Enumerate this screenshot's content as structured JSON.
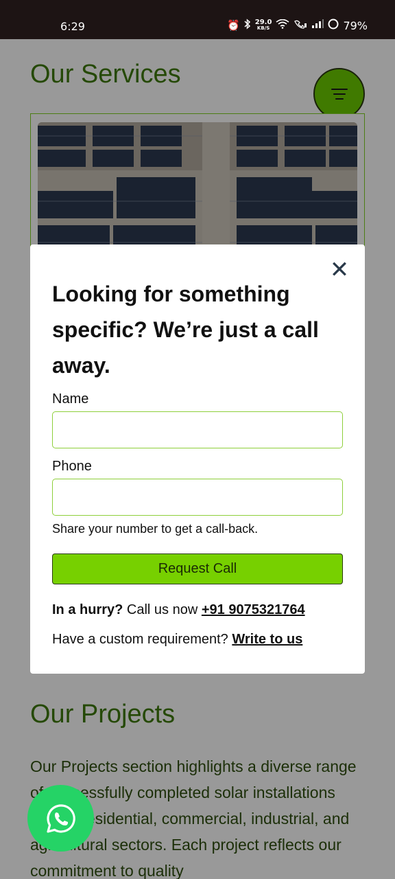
{
  "status_bar": {
    "time": "6:29",
    "speed_value": "29.0",
    "speed_unit": "KB/S",
    "battery": "79%"
  },
  "page": {
    "services_title": "Our Services",
    "projects_title": "Our Projects",
    "projects_text": "Our Projects section highlights a diverse range of successfully completed solar installations across residential, commercial, industrial, and agricultural sectors. Each project reflects our commitment to quality"
  },
  "modal": {
    "title": "Looking for something specific? We’re just a call away.",
    "name_label": "Name",
    "name_value": "",
    "phone_label": "Phone",
    "phone_value": "",
    "hint": "Share your number to get a call-back.",
    "request_button": "Request Call",
    "hurry_bold": "In a hurry?",
    "hurry_text": " Call us now ",
    "phone_link": "+91 9075321764",
    "custom_text": "Have a custom requirement? ",
    "custom_link": "Write to us"
  },
  "colors": {
    "accent_green": "#77d000",
    "title_green": "#3f7a0a",
    "whatsapp": "#25d366",
    "status_bar": "#1d1414"
  },
  "icons": [
    "alarm-icon",
    "bluetooth-icon",
    "wifi-icon",
    "wifi-call-icon",
    "signal-icon",
    "battery-icon",
    "menu-icon",
    "close-icon",
    "whatsapp-icon"
  ]
}
